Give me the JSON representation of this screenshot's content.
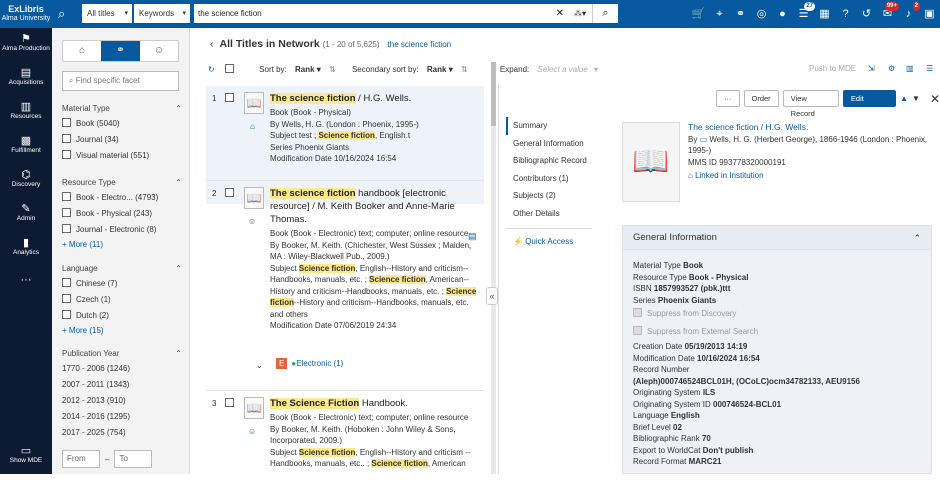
{
  "app": {
    "logo_line1": "ExLibris",
    "logo_line2": "Alma University"
  },
  "search": {
    "scope": "All titles",
    "field": "Keywords",
    "query": "the science fiction"
  },
  "top_badges": {
    "tasks": "27",
    "notifications": "99+",
    "alerts": "2"
  },
  "leftnav": [
    {
      "label": "Alma Production",
      "icon": "alma-icon"
    },
    {
      "label": "Acquisitions",
      "icon": "acquisitions-icon"
    },
    {
      "label": "Resources",
      "icon": "resources-icon"
    },
    {
      "label": "Fulfillment",
      "icon": "fulfillment-icon"
    },
    {
      "label": "Discovery",
      "icon": "discovery-icon"
    },
    {
      "label": "Admin",
      "icon": "admin-icon"
    },
    {
      "label": "Analytics",
      "icon": "analytics-icon"
    },
    {
      "label": "···",
      "icon": "more-icon"
    },
    {
      "label": "Show MDE",
      "icon": "mde-icon"
    }
  ],
  "facets": {
    "search_placeholder": "Find specific facet",
    "material_type": {
      "title": "Material Type",
      "items": [
        "Book (5040)",
        "Journal (34)",
        "Visual material (551)"
      ]
    },
    "resource_type": {
      "title": "Resource Type",
      "items": [
        "Book - Electro... (4793)",
        "Book - Physical (243)",
        "Journal - Electronic (8)"
      ],
      "more": "More (11)"
    },
    "language": {
      "title": "Language",
      "items": [
        "Chinese (7)",
        "Czech (1)",
        "Dutch (2)"
      ],
      "more": "More (15)"
    },
    "publication_year": {
      "title": "Publication Year",
      "items": [
        "1770 - 2006 (1246)",
        "2007 - 2011 (1343)",
        "2012 - 2013 (910)",
        "2014 - 2016 (1295)",
        "2017 - 2025 (754)"
      ]
    },
    "from_placeholder": "From",
    "to_placeholder": "To"
  },
  "results": {
    "title": "All Titles in Network",
    "count": "(1 - 20 of 5,625)",
    "query": "the science fiction",
    "sort_by_label": "Sort by:",
    "sort_by_value": "Rank",
    "secondary_sort_label": "Secondary sort by:",
    "secondary_sort_value": "Rank",
    "expand_label": "Expand:",
    "expand_placeholder": "Select a value",
    "push_to_mde": "Push to MDE",
    "records": [
      {
        "num": "1",
        "title_hl": "The science fiction",
        "title_rest": " / H.G. Wells.",
        "l1": "Book (Book - Physical)",
        "l2": "By Wells, H. G. (London : Phoenix, 1995-)",
        "l3a": "Subject test ; ",
        "l3hl": "Science fiction",
        "l3b": ", English.t",
        "l4": "Series Phoenix Giants",
        "l5": "Modification Date 10/16/2024 16:54"
      },
      {
        "num": "2",
        "title_hl": "The science fiction",
        "title_rest": " handbook [electronic resource] / M. Keith Booker and Anne-Marie Thomas.",
        "l1": "Book (Book - Electronic) text; computer; online resource",
        "l2": "By Booker, M. Keith. (Chichester, West Sussex ; Malden, MA : Wiley-Blackwell Pub., 2009.)",
        "l3a": "Subject ",
        "l3hl": "Science fiction",
        "l3b": ", English--History and criticism--Handbooks, manuals, etc. ; ",
        "l3hl2": "Science fiction",
        "l3c": ", American--History and criticism--Handbooks, manuals, etc. ; ",
        "l3hl3": "Science fiction",
        "l3d": "--History and criticism--Handbooks, manuals, etc. and others",
        "l5": "Modification Date 07/06/2019 24:34",
        "electronic": "Electronic (1)",
        "e_badge": "E"
      },
      {
        "num": "3",
        "title_hl": "The Science Fiction",
        "title_rest": " Handbook.",
        "l1": "Book (Book - Electronic) text; computer; online resource",
        "l2": "By Booker, M. Keith. (Hoboken : John Wiley & Sons, Incorporated, 2009.)",
        "l3a": "Subject ",
        "l3hl": "Science fiction",
        "l3b": ", English--History and criticism -- Handbooks, manuals, etc.. ; ",
        "l3hl2": "Science fiction",
        "l3c": ", American"
      }
    ]
  },
  "detail": {
    "buttons": {
      "more": "···",
      "order": "Order",
      "view_record": "View Record",
      "edit_record": "Edit Record"
    },
    "nav": [
      "Summary",
      "General Information",
      "Bibliographic Record",
      "Contributors (1)",
      "Subjects (2)",
      "Other Details"
    ],
    "quick_access": "Quick Access",
    "title": "The science fiction / H.G. Wells.",
    "by": "By",
    "author": "Wells, H. G. (Herbert George), 1866-1946",
    "pub": "(London : Phoenix, 1995-)",
    "mms": "MMS ID 993778320000191",
    "linked": "Linked in Institution",
    "general_info_title": "General Information",
    "gi": [
      {
        "label": "Material Type ",
        "value": "Book"
      },
      {
        "label": "Resource Type ",
        "value": "Book - Physical"
      },
      {
        "label": "ISBN ",
        "value": "1857993527 (pbk.)ttt"
      },
      {
        "label": "Series ",
        "value": "Phoenix Giants"
      }
    ],
    "suppress_discovery": "Suppress from Discovery",
    "suppress_external": "Suppress from External Search",
    "gi2": [
      {
        "label": "Creation Date ",
        "value": "05/19/2013 14:19"
      },
      {
        "label": "Modification Date ",
        "value": "10/16/2024 16:54"
      },
      {
        "label": "Record Number",
        "value": ""
      },
      {
        "label": "",
        "value": "(Aleph)000746524BCL01H, (OCoLC)ocm34782133, AEU9156"
      },
      {
        "label": "Originating System ",
        "value": "ILS"
      },
      {
        "label": "Originating System ID ",
        "value": "000746524-BCL01"
      },
      {
        "label": "Language ",
        "value": "English"
      },
      {
        "label": "Brief Level ",
        "value": "02"
      },
      {
        "label": "Bibliographic Rank ",
        "value": "70"
      },
      {
        "label": "Export to WorldCat ",
        "value": "Don't publish"
      },
      {
        "label": "Record Format ",
        "value": "MARC21"
      }
    ]
  }
}
